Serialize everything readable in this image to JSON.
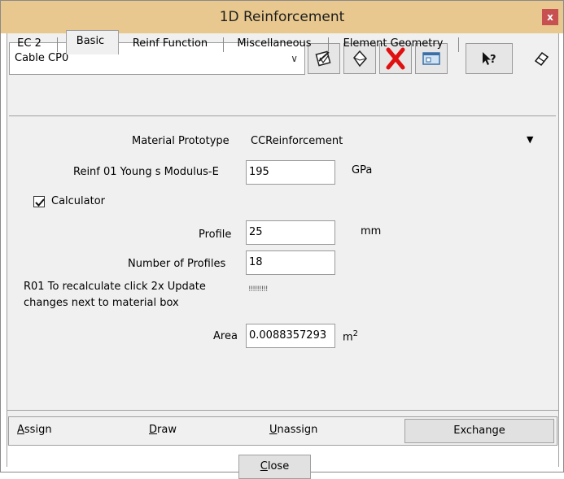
{
  "window": {
    "title": "1D Reinforcement",
    "close_label": "x"
  },
  "toolbar": {
    "selector_value": "Cable CP0",
    "icons": [
      "edit-icon",
      "shape-icon",
      "delete-icon",
      "window-icon",
      "help-pointer-icon",
      "eraser-icon"
    ]
  },
  "tabs": [
    "EC 2",
    "Basic",
    "Reinf Function",
    "Miscellaneous",
    "Element Geometry"
  ],
  "active_tab": "Basic",
  "form": {
    "material_label": "Material Prototype",
    "material_value": "CCReinforcement",
    "young_label": "Reinf 01 Young s Modulus-E",
    "young_value": "195",
    "young_unit": "GPa",
    "calculator_label": "Calculator",
    "calculator_checked": true,
    "profile_label": "Profile",
    "profile_value": "25",
    "profile_unit": "mm",
    "num_profiles_label": "Number of Profiles",
    "num_profiles_value": "18",
    "note_line1": "R01 To recalculate click 2x Update",
    "note_line2": "changes next to material box",
    "note_marker": "!!!!!!!!!",
    "area_label": "Area",
    "area_value": "0.0088357293",
    "area_unit": "m",
    "area_unit_sup": "2"
  },
  "actions": {
    "assign_first": "A",
    "assign_rest": "ssign",
    "draw_first": "D",
    "draw_rest": "raw",
    "unassign_first": "U",
    "unassign_rest": "nassign",
    "exchange": "Exchange",
    "close_first": "C",
    "close_rest": "lose"
  }
}
